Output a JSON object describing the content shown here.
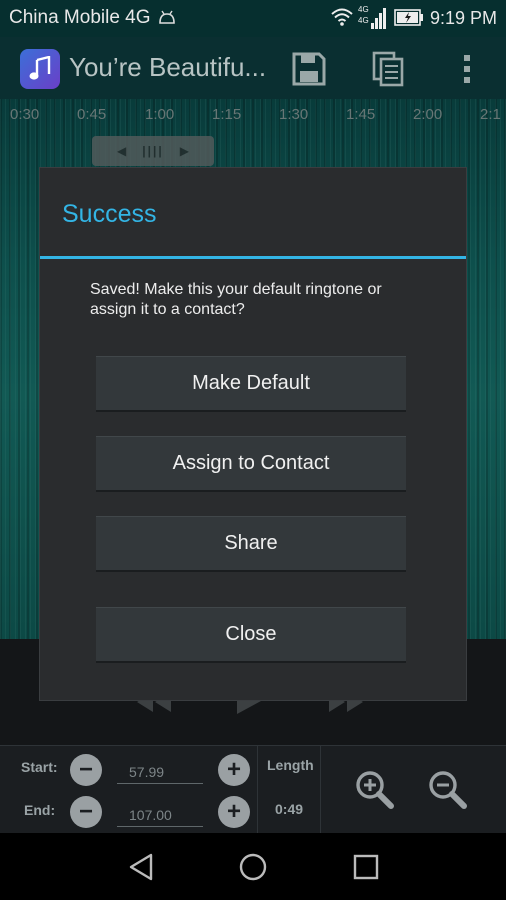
{
  "status_bar": {
    "carrier": "China Mobile 4G",
    "time": "9:19 PM"
  },
  "action_bar": {
    "title": "You’re Beautifu...",
    "icons": [
      "music-note-icon",
      "save-icon",
      "copy-icon",
      "overflow-menu-icon"
    ]
  },
  "timeline": {
    "ticks": [
      "0:30",
      "0:45",
      "1:00",
      "1:15",
      "1:30",
      "1:45",
      "2:00",
      "2:1"
    ]
  },
  "dialog": {
    "title": "Success",
    "message": "Saved! Make this your default ringtone or assign it to a contact?",
    "buttons": {
      "make_default": "Make Default",
      "assign_contact": "Assign to Contact",
      "share": "Share",
      "close": "Close"
    }
  },
  "controls": {
    "start_label": "Start:",
    "start_value": "57.99",
    "end_label": "End:",
    "end_value": "107.00",
    "length_label": "Length",
    "length_value": "0:49"
  },
  "colors": {
    "accent": "#33b5e5",
    "waveform": "#157a75",
    "dialog_bg": "#2a2c2e"
  }
}
